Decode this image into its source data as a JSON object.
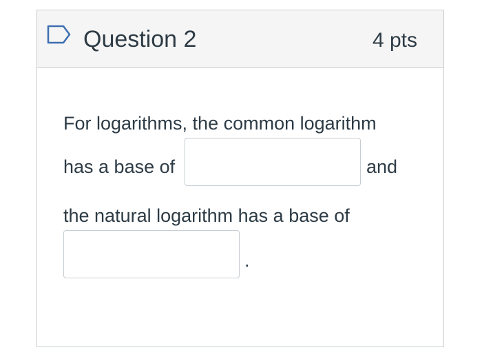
{
  "question": {
    "title": "Question 2",
    "points": "4 pts",
    "flag_icon": "bookmark-flag-icon",
    "border_color": "#c7cdd1",
    "header_bg": "#f5f5f5",
    "flag_color": "#3e6fb0"
  },
  "body": {
    "line1": "For logarithms, the common logarithm",
    "line2_prefix": "has a base of",
    "line2_suffix": "and",
    "line3": "the natural logarithm has a base of",
    "line4_suffix": "."
  },
  "answers": {
    "blank1_value": "",
    "blank2_value": ""
  }
}
